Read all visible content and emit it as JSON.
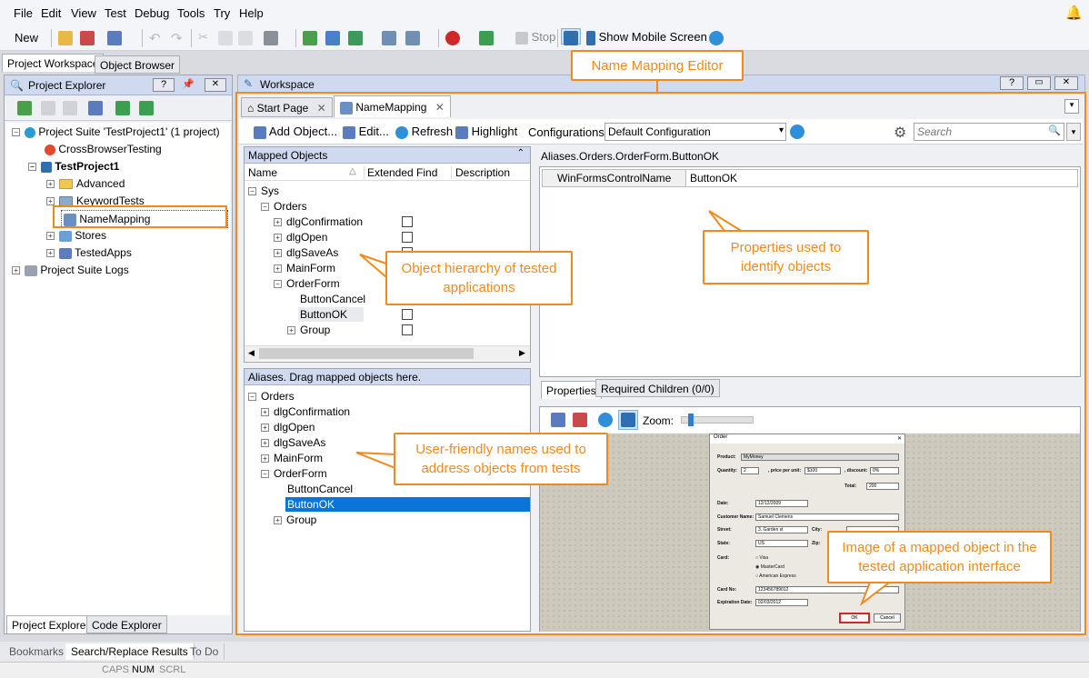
{
  "menu": [
    "File",
    "Edit",
    "View",
    "Test",
    "Debug",
    "Tools",
    "Try",
    "Help"
  ],
  "toolbar": {
    "new_label": "New",
    "stop_label": "Stop",
    "mobile_label": "Show Mobile Screen"
  },
  "left_tabs": [
    "Project Workspace",
    "Object Browser"
  ],
  "project_explorer": {
    "title": "Project Explorer",
    "suite": "Project Suite 'TestProject1' (1 project)",
    "crossbrowser": "CrossBrowserTesting",
    "project": "TestProject1",
    "items": [
      "Advanced",
      "KeywordTests",
      "NameMapping",
      "Stores",
      "TestedApps"
    ],
    "logs": "Project Suite Logs",
    "bottom_tabs": [
      "Project Explorer",
      "Code Explorer"
    ]
  },
  "workspace": {
    "title": "Workspace",
    "tabs": [
      "Start Page",
      "NameMapping"
    ],
    "toolbar": {
      "add": "Add Object...",
      "edit": "Edit...",
      "refresh": "Refresh",
      "highlight": "Highlight",
      "configurations": "Configurations",
      "config_value": "Default Configuration",
      "search_placeholder": "Search"
    }
  },
  "mapped_objects": {
    "title": "Mapped Objects",
    "columns": [
      "Name",
      "Extended Find",
      "Description"
    ],
    "tree": [
      "Sys",
      "Orders",
      "dlgConfirmation",
      "dlgOpen",
      "dlgSaveAs",
      "MainForm",
      "OrderForm",
      "ButtonCancel",
      "ButtonOK",
      "Group"
    ]
  },
  "aliases": {
    "title": "Aliases. Drag mapped objects here.",
    "tree": [
      "Orders",
      "dlgConfirmation",
      "dlgOpen",
      "dlgSaveAs",
      "MainForm",
      "OrderForm",
      "ButtonCancel",
      "ButtonOK",
      "Group"
    ]
  },
  "properties": {
    "path": "Aliases.Orders.OrderForm.ButtonOK",
    "prop_name": "WinFormsControlName",
    "prop_value": "ButtonOK",
    "tabs": [
      "Properties",
      "Required Children (0/0)"
    ],
    "zoom_label": "Zoom:",
    "zoom_level": 0.1
  },
  "order_form": {
    "title": "Order",
    "product_label": "Product:",
    "product_value": "MyMoney",
    "quantity_label": "Quantity:",
    "quantity_value": "2",
    "price_label": ", price per unit:",
    "price_value": "$100",
    "discount_label": ", discount:",
    "discount_value": "0%",
    "total_label": "Total:",
    "total_value": "200",
    "date_label": "Date:",
    "date_value": "12/12/2009",
    "customer_label": "Customer Name:",
    "customer_value": "Samuel Clemens",
    "street_label": "Street:",
    "street_value": "3, Garden st",
    "city_label": "City:",
    "state_label": "State:",
    "state_value": "US",
    "zip_label": "Zip:",
    "card_label": "Card:",
    "cards": [
      "Visa",
      "MasterCard",
      "American Express"
    ],
    "cardno_label": "Card No:",
    "cardno_value": "123456789012",
    "exp_label": "Expiration Date:",
    "exp_value": "02/03/2012",
    "ok": "OK",
    "cancel": "Cancel"
  },
  "callouts": {
    "editor": "Name Mapping Editor",
    "hierarchy": "Object hierarchy of tested applications",
    "props": "Properties used to identify objects",
    "aliases": "User-friendly names used to address objects from tests",
    "image": "Image of a mapped object in the tested application interface"
  },
  "bottom_tabs": [
    "Bookmarks",
    "Search/Replace Results",
    "To Do"
  ],
  "status": [
    "CAPS",
    "NUM",
    "SCRL"
  ],
  "colors": {
    "accent": "#f08a1f",
    "selection": "#0a74d9",
    "header": "#cfdaf0"
  }
}
